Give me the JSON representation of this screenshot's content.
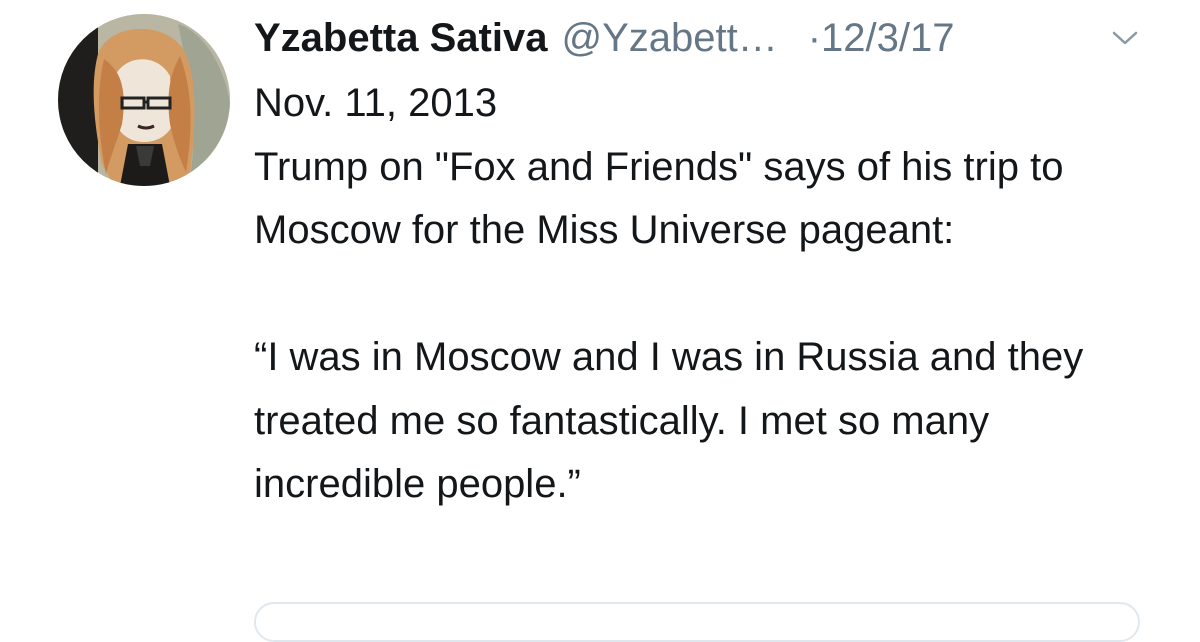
{
  "tweet": {
    "author": {
      "display_name": "Yzabetta Sativa",
      "handle": "@Yzabett…",
      "avatar_icon": "profile-avatar-illustration"
    },
    "separator": "·",
    "date": "12/3/17",
    "menu_icon": "chevron-down-icon",
    "body": {
      "line1": "Nov. 11, 2013",
      "paragraph1": "Trump on \"Fox and Friends\" says of his trip to Moscow for the Miss Universe pageant:",
      "quote": "“I was in Moscow and I was in Russia and they treated me so fantastically. I met so many incredible people.”"
    }
  },
  "colors": {
    "text": "#14171a",
    "secondary_text": "#657786",
    "border": "#e1e8ed"
  }
}
